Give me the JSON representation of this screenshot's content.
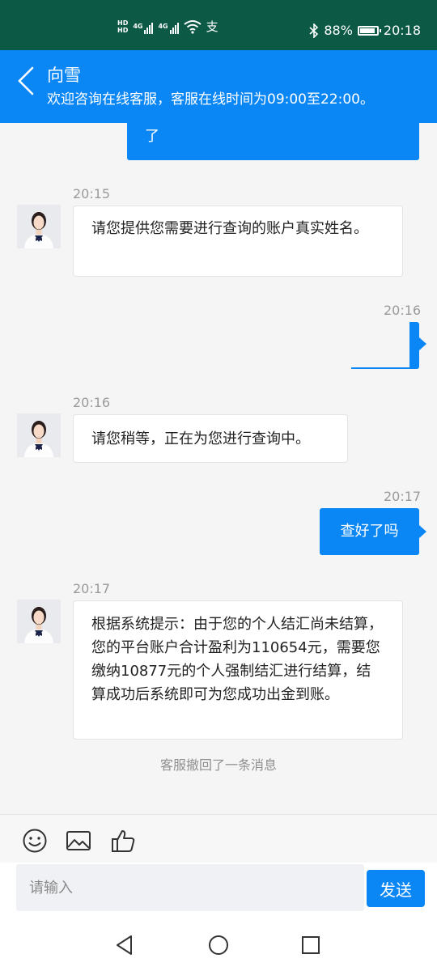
{
  "status_bar": {
    "hd1": "HD",
    "hd2": "HD",
    "net1": "4G",
    "net2": "4G",
    "app_glyph": "支",
    "battery": "88%",
    "battery_level": 0.88,
    "time": "20:18"
  },
  "header": {
    "title": "向雪",
    "subtitle": "欢迎咨询在线客服，客服在线时间为09:00至22:00。"
  },
  "messages": [
    {
      "side": "out",
      "text": "了"
    },
    {
      "side": "in",
      "time": "20:15",
      "text": "请您提供您需要进行查询的账户真实姓名。"
    },
    {
      "side": "out",
      "time": "20:16",
      "text": ""
    },
    {
      "side": "in",
      "time": "20:16",
      "text": "请您稍等，正在为您进行查询中。"
    },
    {
      "side": "out",
      "time": "20:17",
      "text": "查好了吗"
    },
    {
      "side": "in",
      "time": "20:17",
      "text": "根据系统提示：由于您的个人结汇尚未结算，您的平台账户合计盈利为110654元，需要您缴纳10877元的个人强制结汇进行结算，结算成功后系统即可为您成功出金到账。"
    }
  ],
  "notice": "客服撤回了一条消息",
  "toolbar": {
    "icons": [
      "emoji-icon",
      "image-icon",
      "thumbs-up-icon"
    ]
  },
  "input": {
    "placeholder": "请输入",
    "value": ""
  },
  "send_label": "发送",
  "colors": {
    "status_bar": "#0c5a46",
    "brand_blue": "#0b87f5",
    "background": "#f5f5f5"
  }
}
